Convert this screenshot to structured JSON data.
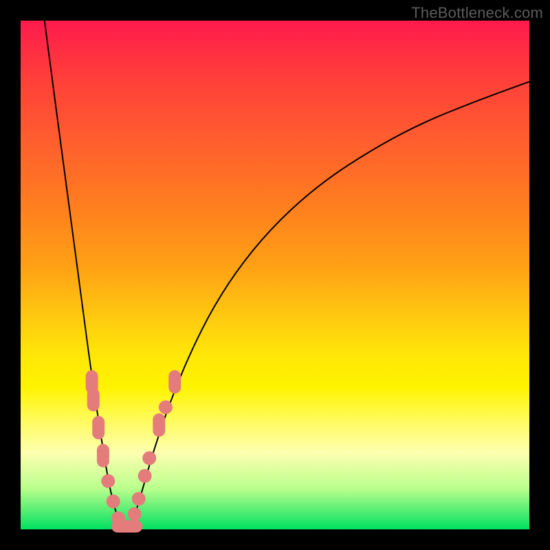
{
  "watermark": "TheBottleneck.com",
  "colors": {
    "frame": "#000000",
    "curve": "#000000",
    "marker": "#e47c7c",
    "gradient_stops": [
      {
        "pos": 0.0,
        "hex": "#ff1a4d"
      },
      {
        "pos": 0.1,
        "hex": "#ff3b3b"
      },
      {
        "pos": 0.22,
        "hex": "#ff5a30"
      },
      {
        "pos": 0.35,
        "hex": "#ff7a20"
      },
      {
        "pos": 0.48,
        "hex": "#ffa015"
      },
      {
        "pos": 0.58,
        "hex": "#ffc810"
      },
      {
        "pos": 0.66,
        "hex": "#ffe808"
      },
      {
        "pos": 0.72,
        "hex": "#fff300"
      },
      {
        "pos": 0.78,
        "hex": "#fffa55"
      },
      {
        "pos": 0.85,
        "hex": "#fcffb0"
      },
      {
        "pos": 0.92,
        "hex": "#b9ff8c"
      },
      {
        "pos": 1.0,
        "hex": "#00e060"
      }
    ]
  },
  "chart_data": {
    "type": "line",
    "title": "",
    "xlabel": "",
    "ylabel": "",
    "xlim": [
      0,
      100
    ],
    "ylim": [
      0,
      100
    ],
    "note": "Axes are unlabeled; values are pixel-read estimates on a 0–100 grid.",
    "series": [
      {
        "name": "left-branch",
        "x": [
          4.7,
          6.0,
          8.0,
          10.0,
          12.0,
          14.0,
          16.0,
          17.0,
          18.0,
          19.0,
          19.8
        ],
        "y": [
          100,
          90,
          75,
          60,
          45,
          30,
          17,
          11,
          6,
          2.5,
          0.5
        ]
      },
      {
        "name": "right-branch",
        "x": [
          21.5,
          22.5,
          24.0,
          26.0,
          29.0,
          33.0,
          38.0,
          44.0,
          51.0,
          59.0,
          68.0,
          78.0,
          89.0,
          100.0
        ],
        "y": [
          0.5,
          3.0,
          8.0,
          15.0,
          24.0,
          34.0,
          44.0,
          53.0,
          61.0,
          68.0,
          74.0,
          79.5,
          84.0,
          88.0
        ]
      }
    ],
    "markers": [
      {
        "x": 14.0,
        "y": 29.0,
        "shape": "pill-vertical"
      },
      {
        "x": 14.3,
        "y": 25.5,
        "shape": "pill-vertical"
      },
      {
        "x": 15.3,
        "y": 20.0,
        "shape": "pill-vertical"
      },
      {
        "x": 16.2,
        "y": 14.5,
        "shape": "pill-vertical"
      },
      {
        "x": 17.2,
        "y": 9.5,
        "shape": "circle"
      },
      {
        "x": 18.2,
        "y": 5.5,
        "shape": "circle"
      },
      {
        "x": 19.2,
        "y": 2.2,
        "shape": "circle"
      },
      {
        "x": 20.0,
        "y": 0.6,
        "shape": "pill-horizontal"
      },
      {
        "x": 21.8,
        "y": 0.6,
        "shape": "pill-horizontal"
      },
      {
        "x": 22.4,
        "y": 3.0,
        "shape": "circle"
      },
      {
        "x": 23.2,
        "y": 6.0,
        "shape": "circle"
      },
      {
        "x": 24.4,
        "y": 10.5,
        "shape": "circle"
      },
      {
        "x": 25.3,
        "y": 14.0,
        "shape": "circle"
      },
      {
        "x": 27.2,
        "y": 20.5,
        "shape": "pill-vertical"
      },
      {
        "x": 28.5,
        "y": 24.0,
        "shape": "circle"
      },
      {
        "x": 30.3,
        "y": 29.0,
        "shape": "pill-vertical"
      }
    ]
  }
}
